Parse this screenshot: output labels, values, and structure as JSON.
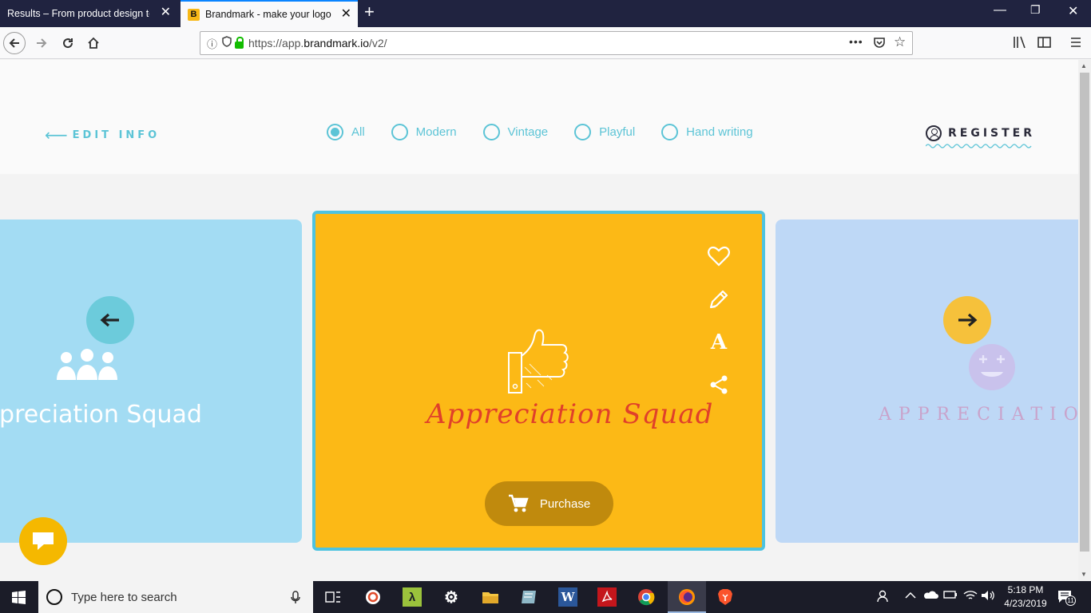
{
  "browser": {
    "tabs": [
      {
        "title": "Results – From product design to d"
      },
      {
        "title": "Brandmark - make your logo in"
      }
    ],
    "url_prefix": "https://app.",
    "url_host": "brandmark.io",
    "url_path": "/v2/"
  },
  "header": {
    "edit_info": "EDIT INFO",
    "filters": [
      {
        "label": "All",
        "checked": true
      },
      {
        "label": "Modern",
        "checked": false
      },
      {
        "label": "Vintage",
        "checked": false
      },
      {
        "label": "Playful",
        "checked": false
      },
      {
        "label": "Hand writing",
        "checked": false
      }
    ],
    "register": "REGISTER"
  },
  "cards": {
    "left": {
      "text": "ppreciation Squad",
      "color": "#a3dcf3"
    },
    "center": {
      "text": "Appreciation Squad",
      "color": "#fcb916",
      "border": "#4ec3e0",
      "text_color": "#e0402a"
    },
    "right": {
      "text": "APPRECIATION SQU",
      "color": "#bed8f6"
    },
    "purchase_label": "Purchase"
  },
  "taskbar": {
    "search_placeholder": "Type here to search",
    "time": "5:18 PM",
    "date": "4/23/2019",
    "notification_count": "11"
  },
  "icons": {
    "side_actions": [
      "heart-icon",
      "pencil-icon",
      "font-icon",
      "share-icon"
    ]
  }
}
